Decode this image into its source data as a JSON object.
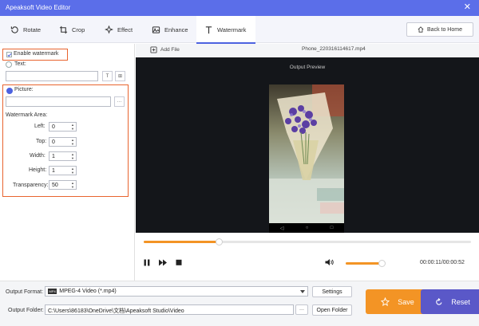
{
  "app": {
    "title": "Apeaksoft Video Editor",
    "close_glyph": "✕"
  },
  "tabs": [
    {
      "label": "Rotate",
      "icon": "rotate-icon"
    },
    {
      "label": "Crop",
      "icon": "crop-icon"
    },
    {
      "label": "Effect",
      "icon": "effect-icon"
    },
    {
      "label": "Enhance",
      "icon": "enhance-icon"
    },
    {
      "label": "Watermark",
      "icon": "watermark-icon",
      "active": true
    }
  ],
  "back_button": {
    "label": "Back to Home"
  },
  "watermark": {
    "enable_label": "Enable watermark",
    "text_label": "Text:",
    "text_value": "",
    "picture_label": "Picture:",
    "picture_path": "",
    "browse_label": "···",
    "area_label": "Watermark Area:",
    "left_label": "Left:",
    "left_value": "0",
    "top_label": "Top:",
    "top_value": "0",
    "width_label": "Width:",
    "width_value": "1",
    "height_label": "Height:",
    "height_value": "1",
    "transparency_label": "Transparency:",
    "transparency_value": "50",
    "text_btn_t": "T",
    "text_btn_grid": "⊞"
  },
  "file_bar": {
    "add_label": "Add File",
    "filename": "Phone_220316114617.mp4"
  },
  "preview": {
    "label": "Output Preview",
    "nav_back": "◁",
    "nav_home": "○",
    "nav_recent": "□"
  },
  "playback": {
    "progress": 0.23,
    "volume": 0.9,
    "current": "00:00:11",
    "total": "00:00:52",
    "separator": "/"
  },
  "output": {
    "format_label": "Output Format:",
    "format_value": "MPEG-4 Video (*.mp4)",
    "format_badge": "MP4",
    "settings_label": "Settings",
    "folder_label": "Output Folder:",
    "folder_value": "C:\\Users\\86183\\OneDrive\\文档\\Apeaksoft Studio\\Video",
    "folder_browse": "···",
    "open_folder_label": "Open Folder"
  },
  "actions": {
    "save_label": "Save",
    "reset_label": "Reset"
  },
  "colors": {
    "accent": "#5b6ee9",
    "orange": "#f39425",
    "highlight": "#e8642f",
    "reset": "#5a58c8"
  }
}
